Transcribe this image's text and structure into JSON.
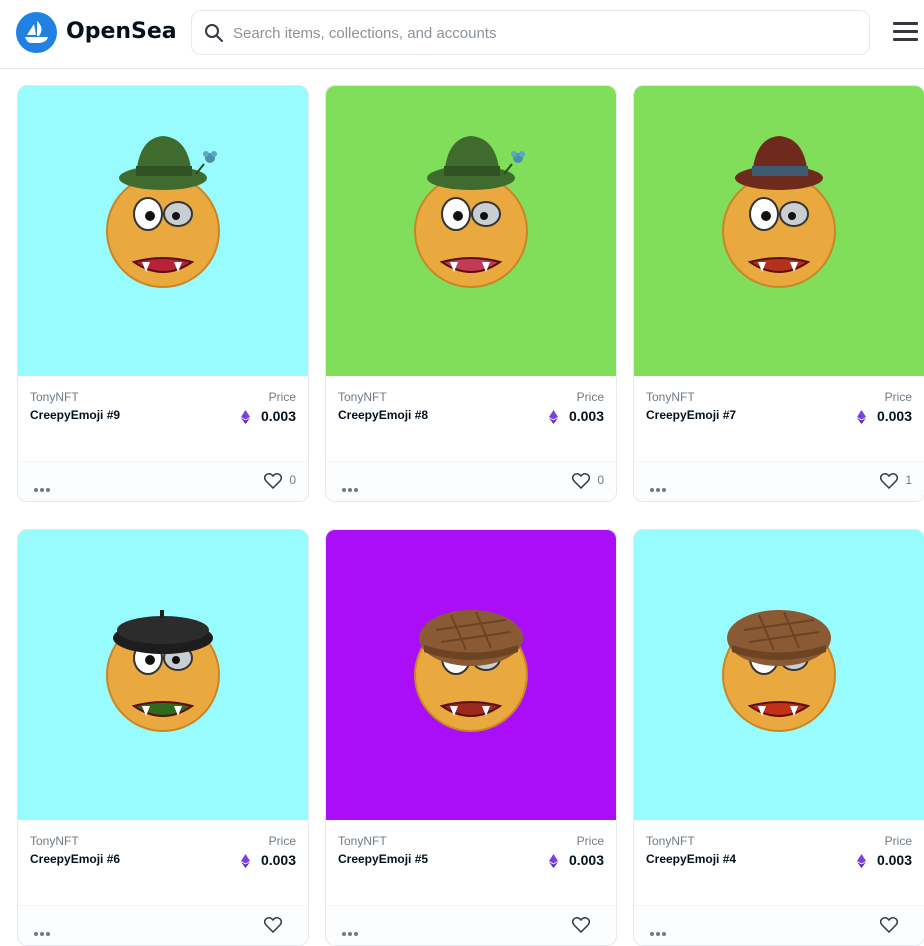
{
  "header": {
    "brand": "OpenSea",
    "search_placeholder": "Search items, collections, and accounts"
  },
  "colors": {
    "accent": "#2081e2",
    "eth": "#7b3fe4"
  },
  "cards": [
    {
      "creator": "TonyNFT",
      "name": "CreepyEmoji #9",
      "price_label": "Price",
      "price": "0.003",
      "likes": "0",
      "bg": "#98fbfe",
      "hat": "#3f6b2e",
      "hat_band": "#2f5322",
      "hat_type": "fedora-flower"
    },
    {
      "creator": "TonyNFT",
      "name": "CreepyEmoji #8",
      "price_label": "Price",
      "price": "0.003",
      "likes": "0",
      "bg": "#80de5a",
      "hat": "#3f6b2e",
      "hat_band": "#2f5322",
      "hat_type": "fedora-flower"
    },
    {
      "creator": "TonyNFT",
      "name": "CreepyEmoji #7",
      "price_label": "Price",
      "price": "0.003",
      "likes": "1",
      "bg": "#80de5a",
      "hat": "#6e2a1c",
      "hat_band": "#3d5a73",
      "hat_type": "fedora"
    },
    {
      "creator": "TonyNFT",
      "name": "CreepyEmoji #6",
      "price_label": "Price",
      "price": "0.003",
      "likes": "",
      "bg": "#98fbfe",
      "hat": "#1d1d1d",
      "hat_band": "#111111",
      "hat_type": "beret"
    },
    {
      "creator": "TonyNFT",
      "name": "CreepyEmoji #5",
      "price_label": "Price",
      "price": "0.003",
      "likes": "",
      "bg": "#aa0df7",
      "hat": "#8a5a34",
      "hat_band": "#6c4424",
      "hat_type": "cap"
    },
    {
      "creator": "TonyNFT",
      "name": "CreepyEmoji #4",
      "price_label": "Price",
      "price": "0.003",
      "likes": "",
      "bg": "#98fbfe",
      "hat": "#8a5a34",
      "hat_band": "#6c4424",
      "hat_type": "cap"
    }
  ]
}
